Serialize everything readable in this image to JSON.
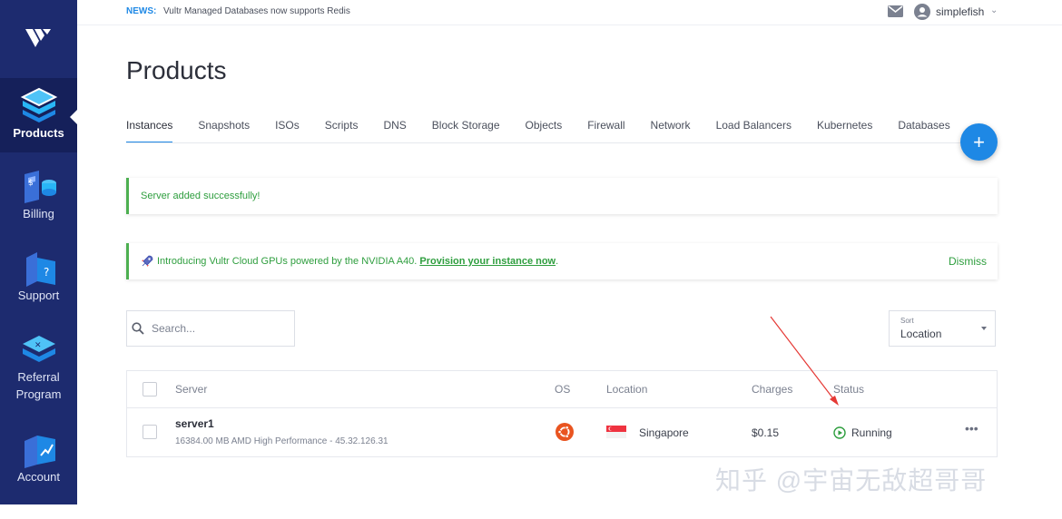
{
  "sidebar": {
    "items": [
      {
        "label": "Products",
        "icon": "products-icon",
        "active": true
      },
      {
        "label": "Billing",
        "icon": "billing-icon",
        "active": false
      },
      {
        "label": "Support",
        "icon": "support-icon",
        "active": false
      },
      {
        "label": "Referral Program",
        "icon": "referral-icon",
        "active": false
      },
      {
        "label": "Account",
        "icon": "account-icon",
        "active": false
      }
    ]
  },
  "topbar": {
    "news_tag": "NEWS:",
    "news_text": "Vultr Managed Databases now supports Redis",
    "username": "simplefish",
    "chevron": "⌄"
  },
  "page": {
    "title": "Products"
  },
  "tabs": [
    {
      "label": "Instances",
      "active": true
    },
    {
      "label": "Snapshots"
    },
    {
      "label": "ISOs"
    },
    {
      "label": "Scripts"
    },
    {
      "label": "DNS"
    },
    {
      "label": "Block Storage"
    },
    {
      "label": "Objects"
    },
    {
      "label": "Firewall"
    },
    {
      "label": "Network"
    },
    {
      "label": "Load Balancers"
    },
    {
      "label": "Kubernetes"
    },
    {
      "label": "Databases"
    }
  ],
  "fab": {
    "label": "+"
  },
  "alerts": {
    "success": "Server added successfully!",
    "promo_text": "Introducing Vultr Cloud GPUs powered by the NVIDIA A40.",
    "promo_link": "Provision your instance now",
    "promo_end": ".",
    "dismiss": "Dismiss"
  },
  "search": {
    "placeholder": "Search..."
  },
  "sort": {
    "label": "Sort",
    "value": "Location"
  },
  "table": {
    "headers": {
      "server": "Server",
      "os": "OS",
      "location": "Location",
      "charges": "Charges",
      "status": "Status"
    },
    "rows": [
      {
        "name": "server1",
        "description": "16384.00 MB AMD High Performance - 45.32.126.31",
        "os": "ubuntu-icon",
        "location": "Singapore",
        "charges": "$0.15",
        "status": "Running",
        "more": "•••"
      }
    ]
  },
  "watermark": "知乎 @宇宙无敌超哥哥",
  "colors": {
    "sidebar": "#1d2b6f",
    "accent": "#1e88e5",
    "success": "#2e9e3e",
    "ubuntu": "#e95420"
  }
}
